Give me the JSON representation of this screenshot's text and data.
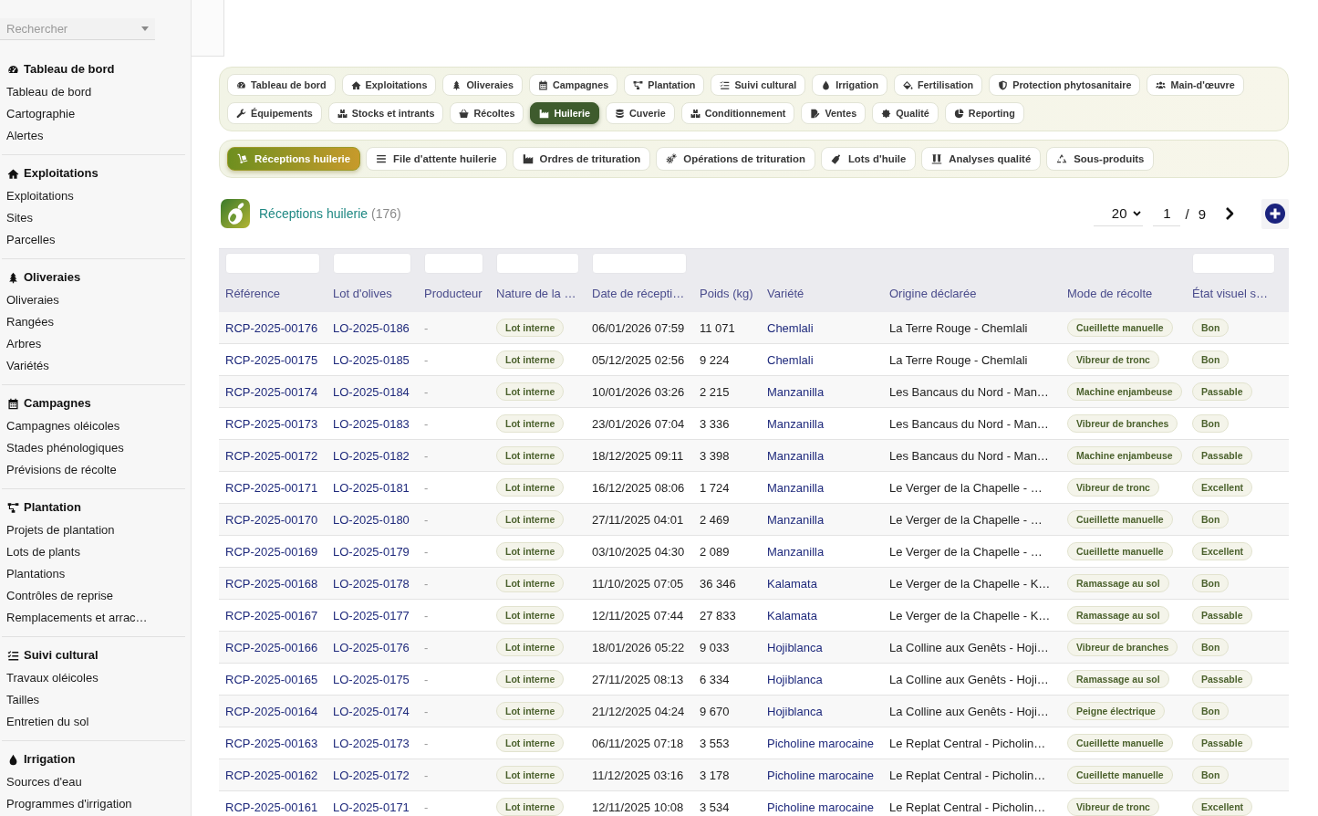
{
  "sidebar": {
    "search": {
      "placeholder": "Rechercher"
    },
    "groups": [
      {
        "title": "Tableau de bord",
        "items": [
          {
            "label": "Tableau de bord"
          },
          {
            "label": "Cartographie"
          },
          {
            "label": "Alertes"
          }
        ]
      },
      {
        "title": "Exploitations",
        "items": [
          {
            "label": "Exploitations"
          },
          {
            "label": "Sites"
          },
          {
            "label": "Parcelles"
          }
        ]
      },
      {
        "title": "Oliveraies",
        "items": [
          {
            "label": "Oliveraies"
          },
          {
            "label": "Rangées"
          },
          {
            "label": "Arbres"
          },
          {
            "label": "Variétés"
          }
        ]
      },
      {
        "title": "Campagnes",
        "items": [
          {
            "label": "Campagnes oléicoles"
          },
          {
            "label": "Stades phénologiques"
          },
          {
            "label": "Prévisions de récolte"
          }
        ]
      },
      {
        "title": "Plantation",
        "items": [
          {
            "label": "Projets de plantation"
          },
          {
            "label": "Lots de plants"
          },
          {
            "label": "Plantations"
          },
          {
            "label": "Contrôles de reprise"
          },
          {
            "label": "Remplacements et arrac…"
          }
        ]
      },
      {
        "title": "Suivi cultural",
        "items": [
          {
            "label": "Travaux oléicoles"
          },
          {
            "label": "Tailles"
          },
          {
            "label": "Entretien du sol"
          }
        ]
      },
      {
        "title": "Irrigation",
        "items": [
          {
            "label": "Sources d'eau"
          },
          {
            "label": "Programmes d'irrigation"
          }
        ]
      }
    ]
  },
  "module_tabs": [
    {
      "label": "Tableau de bord",
      "selected": false
    },
    {
      "label": "Exploitations",
      "selected": false
    },
    {
      "label": "Oliveraies",
      "selected": false
    },
    {
      "label": "Campagnes",
      "selected": false
    },
    {
      "label": "Plantation",
      "selected": false
    },
    {
      "label": "Suivi cultural",
      "selected": false
    },
    {
      "label": "Irrigation",
      "selected": false
    },
    {
      "label": "Fertilisation",
      "selected": false
    },
    {
      "label": "Protection phytosanitaire",
      "selected": false
    },
    {
      "label": "Main-d'œuvre",
      "selected": false
    },
    {
      "label": "Équipements",
      "selected": false
    },
    {
      "label": "Stocks et intrants",
      "selected": false
    },
    {
      "label": "Récoltes",
      "selected": false
    },
    {
      "label": "Huilerie",
      "selected": true
    },
    {
      "label": "Cuverie",
      "selected": false
    },
    {
      "label": "Conditionnement",
      "selected": false
    },
    {
      "label": "Ventes",
      "selected": false
    },
    {
      "label": "Qualité",
      "selected": false
    },
    {
      "label": "Reporting",
      "selected": false
    }
  ],
  "sub_tabs": [
    {
      "label": "Réceptions huilerie",
      "selected": true
    },
    {
      "label": "File d'attente huilerie",
      "selected": false
    },
    {
      "label": "Ordres de trituration",
      "selected": false
    },
    {
      "label": "Opérations de trituration",
      "selected": false
    },
    {
      "label": "Lots d'huile",
      "selected": false
    },
    {
      "label": "Analyses qualité",
      "selected": false
    },
    {
      "label": "Sous-produits",
      "selected": false
    }
  ],
  "list_header": {
    "title": "Réceptions huilerie",
    "count": "(176)",
    "pagination": {
      "page_size": "20",
      "page": "1",
      "separator": "/",
      "total_pages": "9"
    }
  },
  "table": {
    "columns": [
      {
        "label": "Référence",
        "kind": "link",
        "filter": true
      },
      {
        "label": "Lot d'olives",
        "kind": "link",
        "filter": true
      },
      {
        "label": "Producteur",
        "kind": "muted",
        "filter": true
      },
      {
        "label": "Nature de la …",
        "kind": "badge",
        "filter": true
      },
      {
        "label": "Date de récepti…",
        "kind": "text",
        "filter": true
      },
      {
        "label": "Poids (kg)",
        "kind": "text",
        "filter": false
      },
      {
        "label": "Variété",
        "kind": "link",
        "filter": false
      },
      {
        "label": "Origine déclarée",
        "kind": "text",
        "filter": false
      },
      {
        "label": "Mode de récolte",
        "kind": "badge",
        "filter": false
      },
      {
        "label": "État visuel s…",
        "kind": "badge",
        "filter": true
      }
    ],
    "rows": [
      [
        "RCP-2025-00176",
        "LO-2025-0186",
        "-",
        "Lot interne",
        "06/01/2026 07:59",
        "11 071",
        "Chemlali",
        "La Terre Rouge - Chemlali",
        "Cueillette manuelle",
        "Bon"
      ],
      [
        "RCP-2025-00175",
        "LO-2025-0185",
        "-",
        "Lot interne",
        "05/12/2025 02:56",
        "9 224",
        "Chemlali",
        "La Terre Rouge - Chemlali",
        "Vibreur de tronc",
        "Bon"
      ],
      [
        "RCP-2025-00174",
        "LO-2025-0184",
        "-",
        "Lot interne",
        "10/01/2026 03:26",
        "2 215",
        "Manzanilla",
        "Les Bancaus du Nord - Man…",
        "Machine enjambeuse",
        "Passable"
      ],
      [
        "RCP-2025-00173",
        "LO-2025-0183",
        "-",
        "Lot interne",
        "23/01/2026 07:04",
        "3 336",
        "Manzanilla",
        "Les Bancaus du Nord - Man…",
        "Vibreur de branches",
        "Bon"
      ],
      [
        "RCP-2025-00172",
        "LO-2025-0182",
        "-",
        "Lot interne",
        "18/12/2025 09:11",
        "3 398",
        "Manzanilla",
        "Les Bancaus du Nord - Man…",
        "Machine enjambeuse",
        "Passable"
      ],
      [
        "RCP-2025-00171",
        "LO-2025-0181",
        "-",
        "Lot interne",
        "16/12/2025 08:06",
        "1 724",
        "Manzanilla",
        "Le Verger de la Chapelle - …",
        "Vibreur de tronc",
        "Excellent"
      ],
      [
        "RCP-2025-00170",
        "LO-2025-0180",
        "-",
        "Lot interne",
        "27/11/2025 04:01",
        "2 469",
        "Manzanilla",
        "Le Verger de la Chapelle - …",
        "Cueillette manuelle",
        "Bon"
      ],
      [
        "RCP-2025-00169",
        "LO-2025-0179",
        "-",
        "Lot interne",
        "03/10/2025 04:30",
        "2 089",
        "Manzanilla",
        "Le Verger de la Chapelle - …",
        "Cueillette manuelle",
        "Excellent"
      ],
      [
        "RCP-2025-00168",
        "LO-2025-0178",
        "-",
        "Lot interne",
        "11/10/2025 07:05",
        "36 346",
        "Kalamata",
        "Le Verger de la Chapelle - K…",
        "Ramassage au sol",
        "Bon"
      ],
      [
        "RCP-2025-00167",
        "LO-2025-0177",
        "-",
        "Lot interne",
        "12/11/2025 07:44",
        "27 833",
        "Kalamata",
        "Le Verger de la Chapelle - K…",
        "Ramassage au sol",
        "Passable"
      ],
      [
        "RCP-2025-00166",
        "LO-2025-0176",
        "-",
        "Lot interne",
        "18/01/2026 05:22",
        "9 033",
        "Hojiblanca",
        "La Colline aux Genêts - Hoji…",
        "Vibreur de branches",
        "Bon"
      ],
      [
        "RCP-2025-00165",
        "LO-2025-0175",
        "-",
        "Lot interne",
        "27/11/2025 08:13",
        "6 334",
        "Hojiblanca",
        "La Colline aux Genêts - Hoji…",
        "Ramassage au sol",
        "Passable"
      ],
      [
        "RCP-2025-00164",
        "LO-2025-0174",
        "-",
        "Lot interne",
        "21/12/2025 04:24",
        "9 670",
        "Hojiblanca",
        "La Colline aux Genêts - Hoji…",
        "Peigne électrique",
        "Bon"
      ],
      [
        "RCP-2025-00163",
        "LO-2025-0173",
        "-",
        "Lot interne",
        "06/11/2025 07:18",
        "3 553",
        "Picholine marocaine",
        "Le Replat Central - Picholin…",
        "Cueillette manuelle",
        "Passable"
      ],
      [
        "RCP-2025-00162",
        "LO-2025-0172",
        "-",
        "Lot interne",
        "11/12/2025 03:16",
        "3 178",
        "Picholine marocaine",
        "Le Replat Central - Picholin…",
        "Cueillette manuelle",
        "Bon"
      ],
      [
        "RCP-2025-00161",
        "LO-2025-0171",
        "-",
        "Lot interne",
        "12/11/2025 10:08",
        "3 534",
        "Picholine marocaine",
        "Le Replat Central - Picholin…",
        "Vibreur de tronc",
        "Excellent"
      ]
    ]
  }
}
